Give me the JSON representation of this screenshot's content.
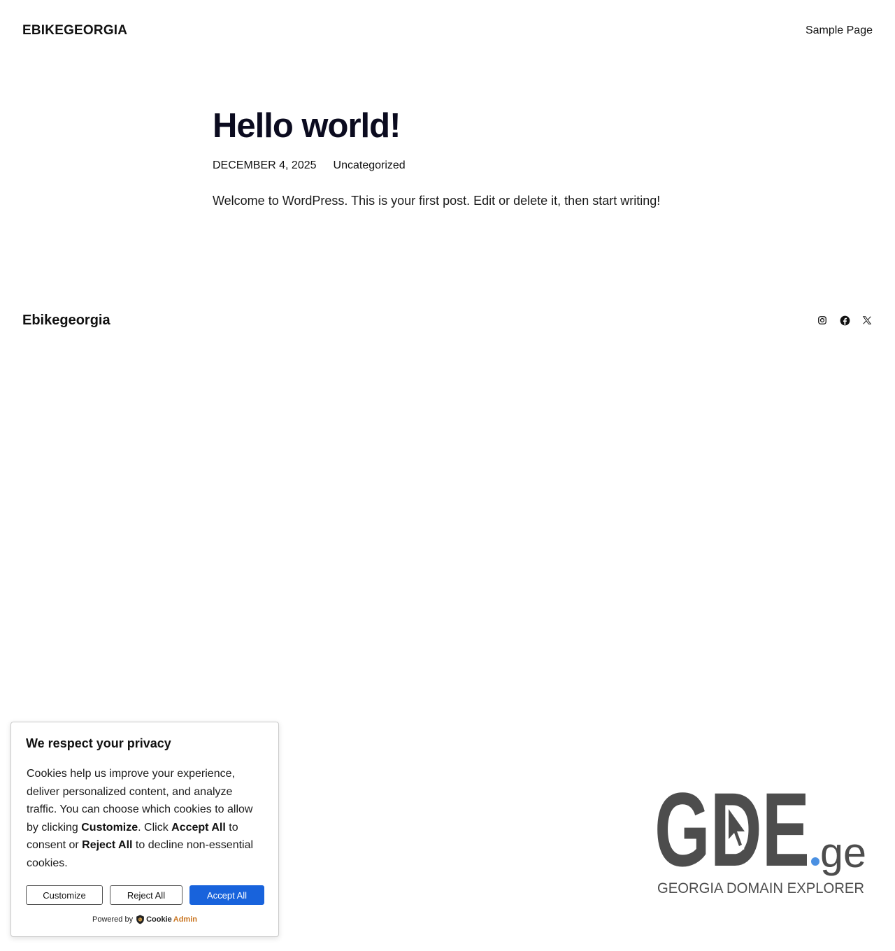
{
  "header": {
    "site_title": "EBIKEGEORGIA",
    "nav": [
      {
        "label": "Sample Page"
      }
    ]
  },
  "post": {
    "title": "Hello world!",
    "date": "DECEMBER 4, 2025",
    "category": "Uncategorized",
    "content": "Welcome to WordPress. This is your first post. Edit or delete it, then start writing!"
  },
  "footer": {
    "site_title": "Ebikegeorgia",
    "social": [
      {
        "icon": "instagram-icon"
      },
      {
        "icon": "facebook-icon"
      },
      {
        "icon": "x-icon"
      }
    ]
  },
  "cookie_banner": {
    "title": "We respect your privacy",
    "message_parts": [
      "Cookies help us improve your experience, deliver personalized content, and analyze traffic. You can choose which cookies to allow by clicking ",
      "Customize",
      ". Click ",
      "Accept All",
      " to consent or ",
      "Reject All",
      " to decline non-essential cookies."
    ],
    "buttons": {
      "customize": "Customize",
      "reject": "Reject All",
      "accept": "Accept All"
    },
    "powered_by": "Powered by",
    "brand_cookie": "Cookie",
    "brand_admin": "Admin",
    "accent_color": "#1863dc"
  },
  "badge": {
    "logo_text": "GDE",
    "logo_suffix": "ge",
    "tagline": "GEORGIA DOMAIN EXPLORER",
    "dot_color": "#4a90e2",
    "logo_color": "#4d4d4d"
  }
}
